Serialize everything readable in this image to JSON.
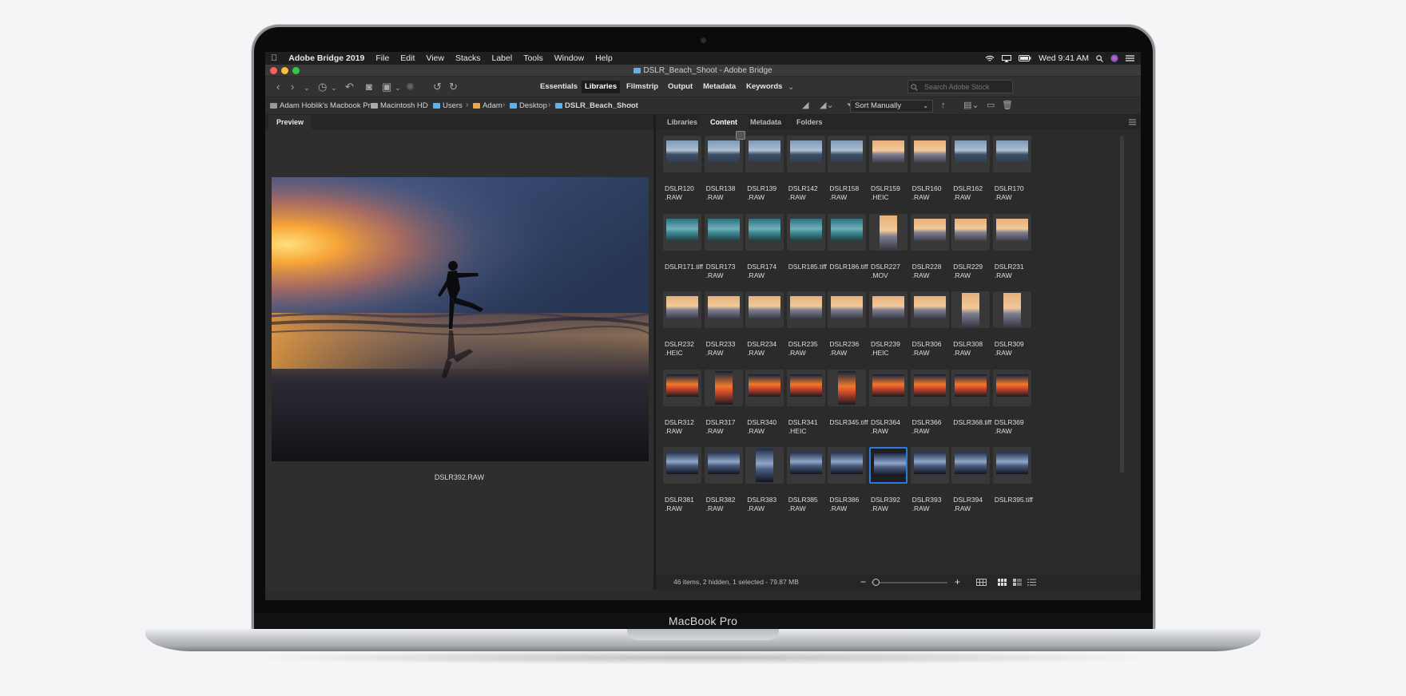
{
  "menubar": {
    "apple": "",
    "app": "Adobe Bridge 2019",
    "items": [
      "File",
      "Edit",
      "View",
      "Stacks",
      "Label",
      "Tools",
      "Window",
      "Help"
    ],
    "clock": "Wed 9:41 AM"
  },
  "window": {
    "title": "DSLR_Beach_Shoot - Adobe Bridge"
  },
  "toolbar": {
    "workspaces": [
      "Essentials",
      "Libraries",
      "Filmstrip",
      "Output",
      "Metadata",
      "Keywords"
    ],
    "active_workspace": "Libraries",
    "search_placeholder": "Search Adobe Stock"
  },
  "path": {
    "crumbs": [
      "Adam Hoblik's Macbook Pro",
      "Macintosh HD",
      "Users",
      "Adam",
      "Desktop",
      "DSLR_Beach_Shoot"
    ],
    "sort": "Sort Manually"
  },
  "preview": {
    "tab": "Preview",
    "caption": "DSLR392.RAW"
  },
  "content": {
    "tabs": [
      "Libraries",
      "Content",
      "Metadata",
      "Folders"
    ],
    "active_tab": "Content",
    "selected": "DSLR392.RAW",
    "files": [
      [
        "DSLR120",
        ".RAW"
      ],
      [
        "DSLR138",
        ".RAW"
      ],
      [
        "DSLR139",
        ".RAW"
      ],
      [
        "DSLR142",
        ".RAW"
      ],
      [
        "DSLR158",
        ".RAW"
      ],
      [
        "DSLR159",
        ".HEIC"
      ],
      [
        "DSLR160",
        ".RAW"
      ],
      [
        "DSLR162",
        ".RAW"
      ],
      [
        "DSLR170",
        ".RAW"
      ],
      [
        "DSLR171.tiff",
        ""
      ],
      [
        "DSLR173",
        ".RAW"
      ],
      [
        "DSLR174",
        ".RAW"
      ],
      [
        "DSLR185.tiff",
        ""
      ],
      [
        "DSLR186.tiff",
        ""
      ],
      [
        "DSLR227",
        ".MOV"
      ],
      [
        "DSLR228",
        ".RAW"
      ],
      [
        "DSLR229",
        ".RAW"
      ],
      [
        "DSLR231",
        ".RAW"
      ],
      [
        "DSLR232",
        ".HEIC"
      ],
      [
        "DSLR233",
        ".RAW"
      ],
      [
        "DSLR234",
        ".RAW"
      ],
      [
        "DSLR235",
        ".RAW"
      ],
      [
        "DSLR236",
        ".RAW"
      ],
      [
        "DSLR239",
        ".HEIC"
      ],
      [
        "DSLR306",
        ".RAW"
      ],
      [
        "DSLR308",
        ".RAW"
      ],
      [
        "DSLR309",
        ".RAW"
      ],
      [
        "DSLR312",
        ".RAW"
      ],
      [
        "DSLR317",
        ".RAW"
      ],
      [
        "DSLR340",
        ".RAW"
      ],
      [
        "DSLR341",
        ".HEIC"
      ],
      [
        "DSLR345.tiff",
        ""
      ],
      [
        "DSLR364",
        ".RAW"
      ],
      [
        "DSLR366",
        ".RAW"
      ],
      [
        "DSLR368.tiff",
        ""
      ],
      [
        "DSLR369",
        ".RAW"
      ],
      [
        "DSLR381",
        ".RAW"
      ],
      [
        "DSLR382",
        ".RAW"
      ],
      [
        "DSLR383",
        ".RAW"
      ],
      [
        "DSLR385",
        ".RAW"
      ],
      [
        "DSLR386",
        ".RAW"
      ],
      [
        "DSLR392",
        ".RAW"
      ],
      [
        "DSLR393",
        ".RAW"
      ],
      [
        "DSLR394",
        ".RAW"
      ],
      [
        "DSLR395.tiff",
        ""
      ]
    ],
    "status": "46 items, 2 hidden, 1 selected - 79.87 MB"
  },
  "device": {
    "label": "MacBook Pro"
  },
  "colors": {
    "accent": "#2a7be0",
    "folder": "#5ab3f0",
    "panel": "#2b2b2b"
  }
}
